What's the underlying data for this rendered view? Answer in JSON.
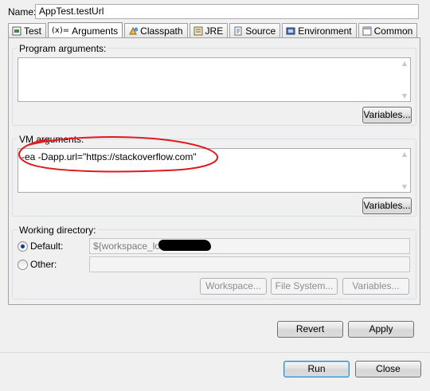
{
  "name": {
    "label": "Name:",
    "value": "AppTest.testUrl"
  },
  "tabs": [
    {
      "label": "Test",
      "icon": "test-icon",
      "active": false
    },
    {
      "label": "Arguments",
      "icon": "arguments-icon",
      "icon_text": "(x)=",
      "active": true
    },
    {
      "label": "Classpath",
      "icon": "classpath-icon",
      "active": false
    },
    {
      "label": "JRE",
      "icon": "jre-icon",
      "active": false
    },
    {
      "label": "Source",
      "icon": "source-icon",
      "active": false
    },
    {
      "label": "Environment",
      "icon": "environment-icon",
      "active": false
    },
    {
      "label": "Common",
      "icon": "common-icon",
      "active": false
    }
  ],
  "program_args": {
    "title": "Program arguments:",
    "value": "",
    "variables_label": "Variables..."
  },
  "vm_args": {
    "title": "VM arguments:",
    "value": "-ea -Dapp.url=\"https://stackoverflow.com\"",
    "variables_label": "Variables...",
    "highlight_color": "#e0191e"
  },
  "working_dir": {
    "title": "Working directory:",
    "default_label": "Default:",
    "default_value": "${workspace_loc:",
    "other_label": "Other:",
    "other_value": "",
    "selected": "default",
    "workspace_label": "Workspace...",
    "filesystem_label": "File System...",
    "variables_label": "Variables..."
  },
  "actions": {
    "revert": "Revert",
    "apply": "Apply",
    "run": "Run",
    "close": "Close"
  }
}
